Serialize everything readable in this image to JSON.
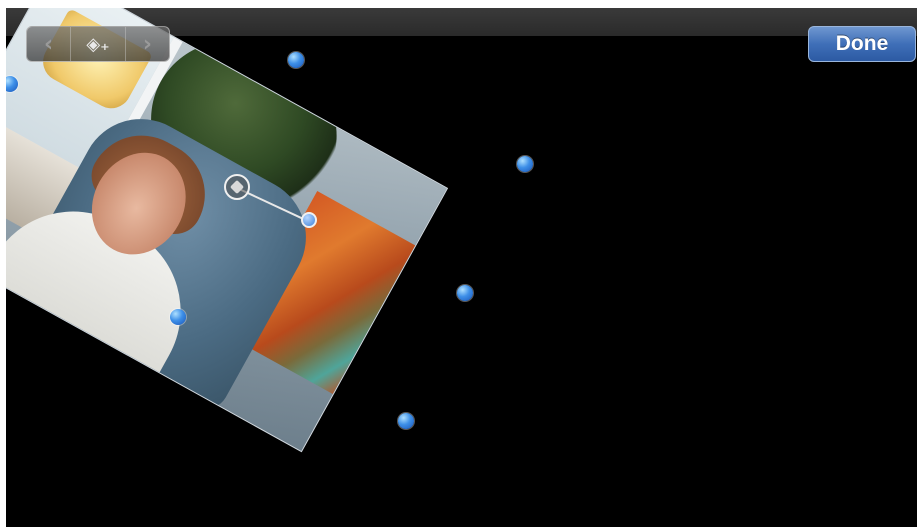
{
  "toolbar": {
    "back_glyph": "‹",
    "keyframe_glyph": "◈₊",
    "forward_glyph": "›",
    "done_label": "Done"
  },
  "icons": {
    "back": "chevron-left-icon",
    "keyframe": "add-keyframe-icon",
    "forward": "chevron-right-icon"
  },
  "colors": {
    "accent_blue": "#3d8fe8",
    "done_button": "#3f6fb8",
    "canvas": "#000000"
  }
}
